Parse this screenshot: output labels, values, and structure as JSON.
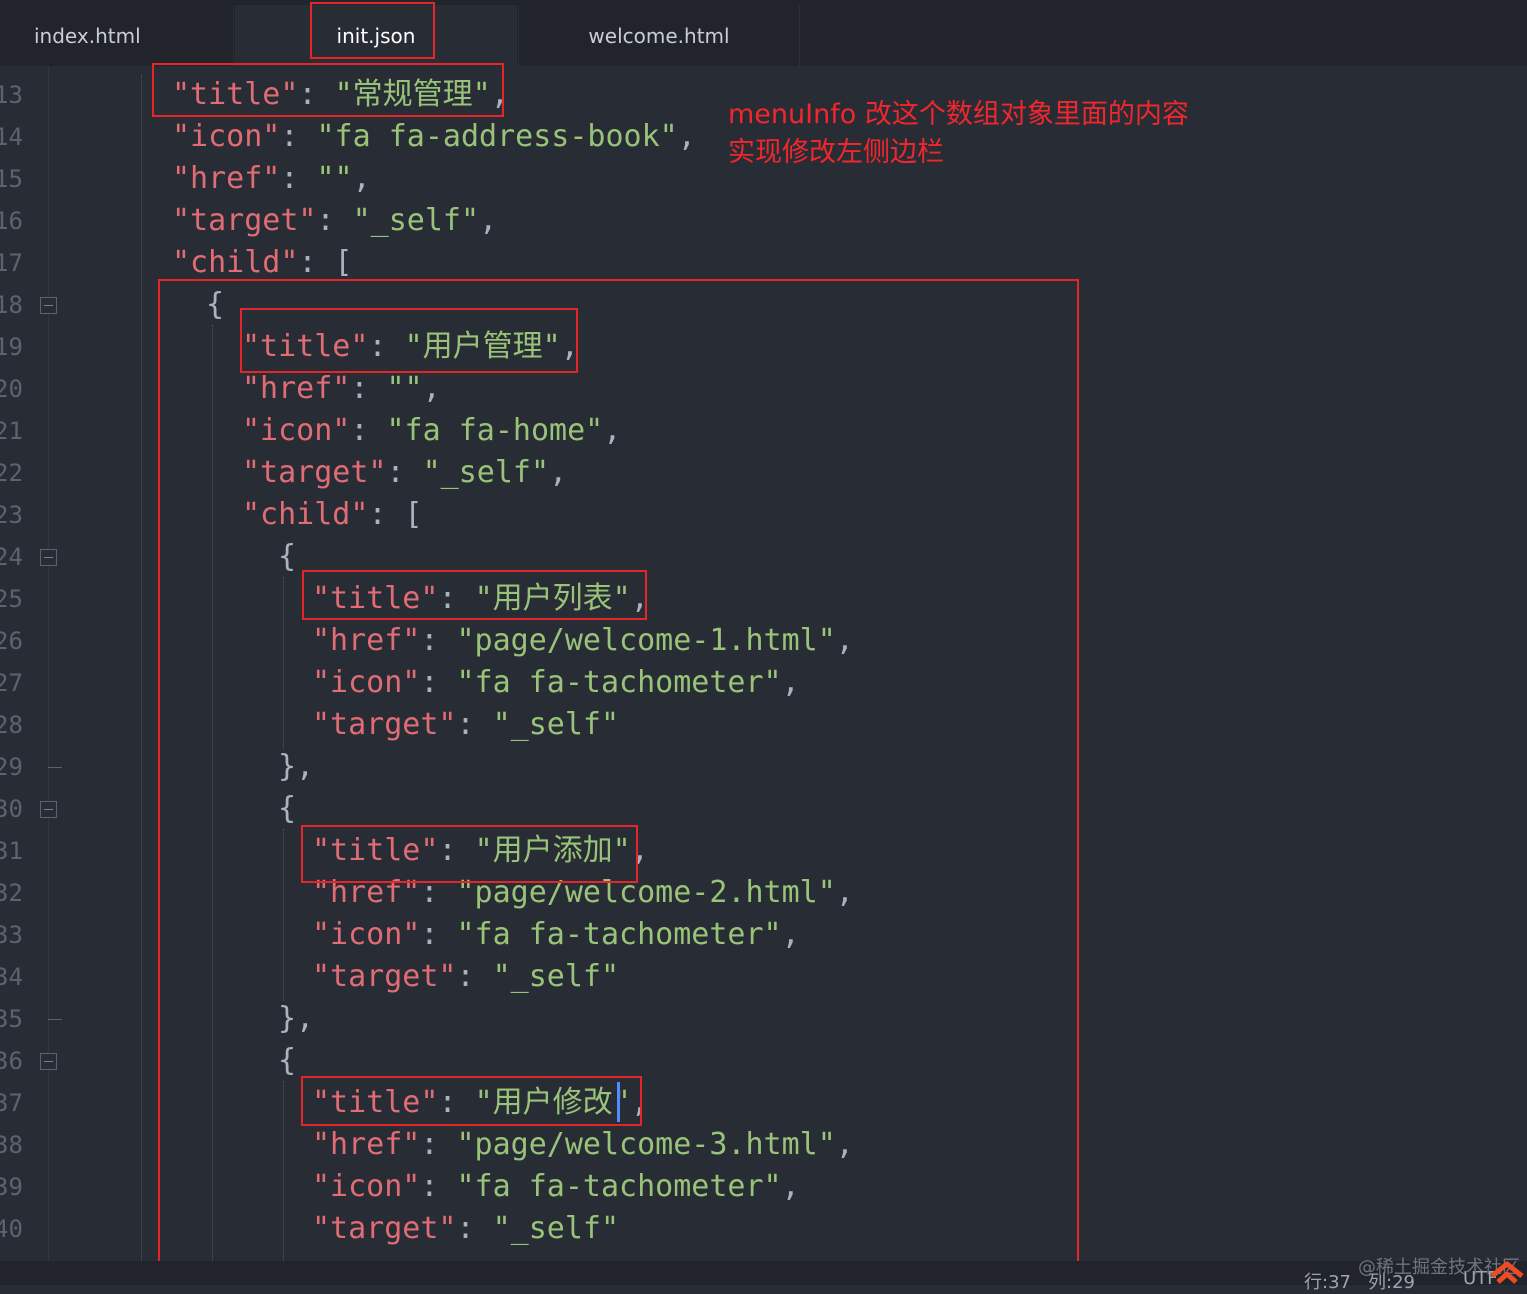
{
  "tabs": [
    {
      "label": "index.html"
    },
    {
      "label": "init.json"
    },
    {
      "label": "welcome.html"
    }
  ],
  "annotation": {
    "line1": "menuInfo 改这个数组对象里面的内容",
    "line2": "实现修改左侧边栏"
  },
  "lines": [
    {
      "n": "13",
      "tokens": [
        [
          "k",
          "\"title\""
        ],
        [
          "p",
          ": "
        ],
        [
          "s",
          "\"常规管理\""
        ],
        [
          "p",
          ","
        ]
      ]
    },
    {
      "n": "14",
      "tokens": [
        [
          "k",
          "\"icon\""
        ],
        [
          "p",
          ": "
        ],
        [
          "s",
          "\"fa fa-address-book\""
        ],
        [
          "p",
          ","
        ]
      ]
    },
    {
      "n": "15",
      "tokens": [
        [
          "k",
          "\"href\""
        ],
        [
          "p",
          ": "
        ],
        [
          "s",
          "\"\""
        ],
        [
          "p",
          ","
        ]
      ]
    },
    {
      "n": "16",
      "tokens": [
        [
          "k",
          "\"target\""
        ],
        [
          "p",
          ": "
        ],
        [
          "s",
          "\"_self\""
        ],
        [
          "p",
          ","
        ]
      ]
    },
    {
      "n": "17",
      "tokens": [
        [
          "k",
          "\"child\""
        ],
        [
          "p",
          ": ["
        ]
      ]
    },
    {
      "n": "18",
      "tokens": [
        [
          "p",
          "{"
        ]
      ]
    },
    {
      "n": "19",
      "tokens": [
        [
          "k",
          "\"title\""
        ],
        [
          "p",
          ": "
        ],
        [
          "s",
          "\"用户管理\""
        ],
        [
          "p",
          ","
        ]
      ]
    },
    {
      "n": "20",
      "tokens": [
        [
          "k",
          "\"href\""
        ],
        [
          "p",
          ": "
        ],
        [
          "s",
          "\"\""
        ],
        [
          "p",
          ","
        ]
      ]
    },
    {
      "n": "21",
      "tokens": [
        [
          "k",
          "\"icon\""
        ],
        [
          "p",
          ": "
        ],
        [
          "s",
          "\"fa fa-home\""
        ],
        [
          "p",
          ","
        ]
      ]
    },
    {
      "n": "22",
      "tokens": [
        [
          "k",
          "\"target\""
        ],
        [
          "p",
          ": "
        ],
        [
          "s",
          "\"_self\""
        ],
        [
          "p",
          ","
        ]
      ]
    },
    {
      "n": "23",
      "tokens": [
        [
          "k",
          "\"child\""
        ],
        [
          "p",
          ": ["
        ]
      ]
    },
    {
      "n": "24",
      "tokens": [
        [
          "p",
          "{"
        ]
      ]
    },
    {
      "n": "25",
      "tokens": [
        [
          "k",
          "\"title\""
        ],
        [
          "p",
          ": "
        ],
        [
          "s",
          "\"用户列表\""
        ],
        [
          "p",
          ","
        ]
      ]
    },
    {
      "n": "26",
      "tokens": [
        [
          "k",
          "\"href\""
        ],
        [
          "p",
          ": "
        ],
        [
          "s",
          "\"page/welcome-1.html\""
        ],
        [
          "p",
          ","
        ]
      ]
    },
    {
      "n": "27",
      "tokens": [
        [
          "k",
          "\"icon\""
        ],
        [
          "p",
          ": "
        ],
        [
          "s",
          "\"fa fa-tachometer\""
        ],
        [
          "p",
          ","
        ]
      ]
    },
    {
      "n": "28",
      "tokens": [
        [
          "k",
          "\"target\""
        ],
        [
          "p",
          ": "
        ],
        [
          "s",
          "\"_self\""
        ]
      ]
    },
    {
      "n": "29",
      "tokens": [
        [
          "p",
          "},"
        ]
      ]
    },
    {
      "n": "30",
      "tokens": [
        [
          "p",
          "{"
        ]
      ]
    },
    {
      "n": "31",
      "tokens": [
        [
          "k",
          "\"title\""
        ],
        [
          "p",
          ": "
        ],
        [
          "s",
          "\"用户添加\""
        ],
        [
          "p",
          ","
        ]
      ]
    },
    {
      "n": "32",
      "tokens": [
        [
          "k",
          "\"href\""
        ],
        [
          "p",
          ": "
        ],
        [
          "s",
          "\"page/welcome-2.html\""
        ],
        [
          "p",
          ","
        ]
      ]
    },
    {
      "n": "33",
      "tokens": [
        [
          "k",
          "\"icon\""
        ],
        [
          "p",
          ": "
        ],
        [
          "s",
          "\"fa fa-tachometer\""
        ],
        [
          "p",
          ","
        ]
      ]
    },
    {
      "n": "34",
      "tokens": [
        [
          "k",
          "\"target\""
        ],
        [
          "p",
          ": "
        ],
        [
          "s",
          "\"_self\""
        ]
      ]
    },
    {
      "n": "35",
      "tokens": [
        [
          "p",
          "},"
        ]
      ]
    },
    {
      "n": "36",
      "tokens": [
        [
          "p",
          "{"
        ]
      ]
    },
    {
      "n": "37",
      "tokens": [
        [
          "k",
          "\"title\""
        ],
        [
          "p",
          ": "
        ],
        [
          "s",
          "\"用户修改\""
        ],
        [
          "p",
          ","
        ]
      ]
    },
    {
      "n": "38",
      "tokens": [
        [
          "k",
          "\"href\""
        ],
        [
          "p",
          ": "
        ],
        [
          "s",
          "\"page/welcome-3.html\""
        ],
        [
          "p",
          ","
        ]
      ]
    },
    {
      "n": "39",
      "tokens": [
        [
          "k",
          "\"icon\""
        ],
        [
          "p",
          ": "
        ],
        [
          "s",
          "\"fa fa-tachometer\""
        ],
        [
          "p",
          ","
        ]
      ]
    },
    {
      "n": "40",
      "tokens": [
        [
          "k",
          "\"target\""
        ],
        [
          "p",
          ": "
        ],
        [
          "s",
          "\"_self\""
        ]
      ]
    }
  ],
  "status": {
    "line": "行:37",
    "col": "列:29",
    "encoding": "UTF"
  },
  "watermark": "@稀土掘金技术社区",
  "colors": {
    "background": "#282c34",
    "key": "#e06c75",
    "string": "#98c379",
    "punct": "#abb2bf",
    "annotation_red": "#e5252a"
  }
}
